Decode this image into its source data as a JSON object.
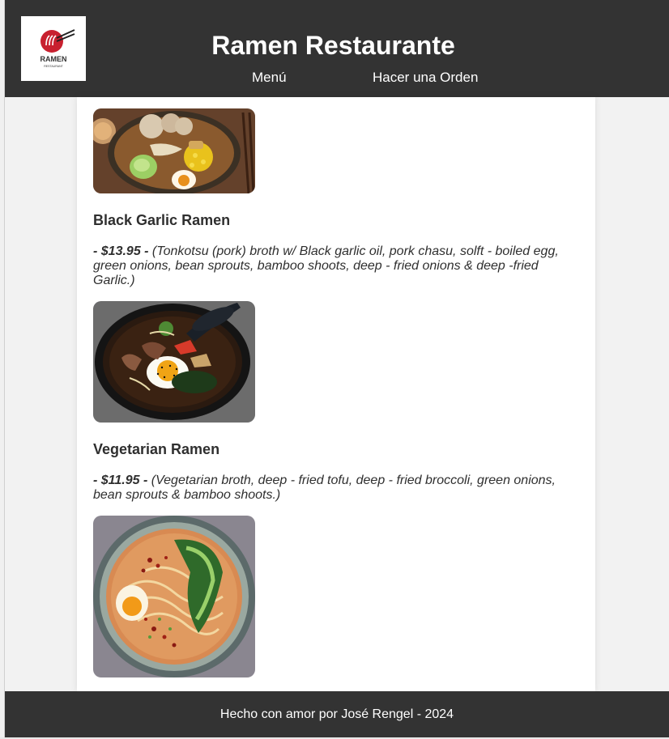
{
  "header": {
    "title": "Ramen Restaurante",
    "logo_text": "RAMEN",
    "logo_subtext": "RESTAURANT",
    "nav": [
      {
        "label": "Menú"
      },
      {
        "label": "Hacer una Orden"
      }
    ]
  },
  "dishes": [
    {
      "image": "ramen-bowl-photo"
    },
    {
      "title": "Black Garlic Ramen",
      "price": "- $13.95 -",
      "description": " (Tonkotsu (pork) broth w/ Black garlic oil, pork chasu, solft - boiled egg, green onions, bean sprouts, bamboo shoots, deep - fried onions & deep -fried Garlic.)",
      "image": "black-garlic-ramen-photo"
    },
    {
      "title": "Vegetarian Ramen",
      "price": "- $11.95 -",
      "description": " (Vegetarian broth, deep - fried tofu, deep - fried broccoli, green onions, bean sprouts & bamboo shoots.)",
      "image": "vegetarian-ramen-photo"
    }
  ],
  "footer": {
    "text": "Hecho con amor por José Rengel - 2024"
  },
  "colors": {
    "header_bg": "#333333",
    "logo_red": "#c8202f",
    "page_bg": "#f2f2f2"
  }
}
